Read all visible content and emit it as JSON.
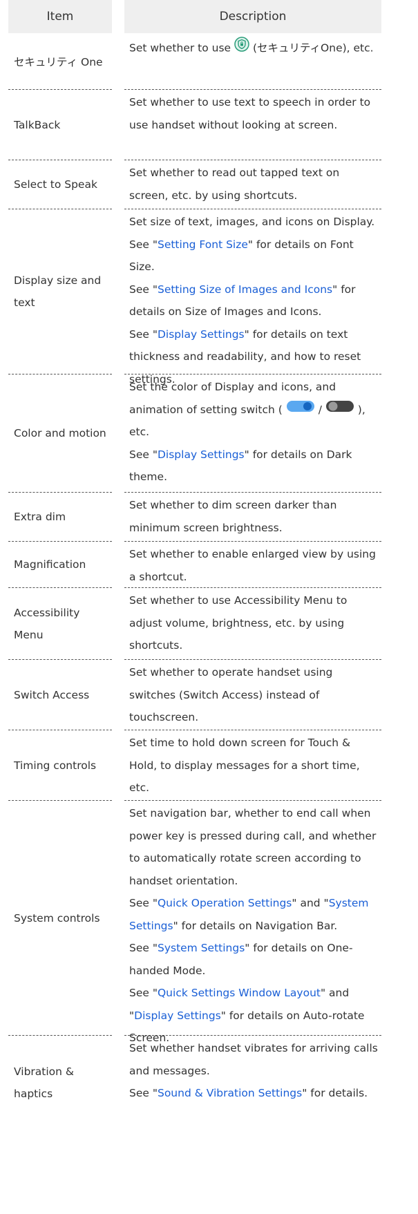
{
  "header": {
    "item": "Item",
    "description": "Description"
  },
  "rows": [
    {
      "item": "セキュリティ One",
      "desc_a": "Set whether to use ",
      "desc_b": " (セキュリティOne), etc."
    },
    {
      "item": "TalkBack",
      "desc": "Set whether to use text to speech in order to use handset without looking at screen."
    },
    {
      "item": "Select to Speak",
      "desc": "Set whether to read out tapped text on screen, etc. by using shortcuts."
    },
    {
      "item": "Display size and text",
      "desc": "Set size of text, images, and icons on Display.",
      "see1_link": "Setting Font Size",
      "see1_rest": " for details on Font Size.",
      "see2_link": "Setting Size of Images and Icons",
      "see2_rest": " for details on Size of Images and Icons.",
      "see3_link": "Display Settings",
      "see3_rest": " for details on text thickness and readability, and how to reset settings."
    },
    {
      "item": "Color and motion",
      "desc_a": "Set the color of Display and icons, and animation of setting switch ( ",
      "desc_b": " / ",
      "desc_c": " ), etc.",
      "see1_link": "Display Settings",
      "see1_rest": " for details on Dark theme."
    },
    {
      "item": "Extra dim",
      "desc": "Set whether to dim screen darker than minimum screen brightness."
    },
    {
      "item": "Magnification",
      "desc": "Set whether to enable enlarged view by using a shortcut."
    },
    {
      "item": "Accessibility Menu",
      "desc": "Set whether to use Accessibility Menu to adjust volume, brightness, etc. by using shortcuts."
    },
    {
      "item": "Switch Access",
      "desc": "Set whether to operate handset using switches (Switch Access) instead of touchscreen."
    },
    {
      "item": "Timing controls",
      "desc": "Set time to hold down screen for Touch & Hold, to display messages for a short time, etc."
    },
    {
      "item": "System controls",
      "desc": "Set navigation bar, whether to end call when power key is pressed during call, and whether to automatically rotate screen according to handset orientation.",
      "see1_link": "Quick Operation Settings",
      "see1_mid": " and ",
      "see1_link2": "System Settings",
      "see1_rest": " for details on Navigation Bar.",
      "see2_link": "System Settings",
      "see2_rest": " for details on One-handed Mode.",
      "see3_link": "Quick Settings Window Layout",
      "see3_mid": " and ",
      "see3_link2": "Display Settings",
      "see3_rest": " for details on Auto-rotate Screen."
    },
    {
      "item": "Vibration & haptics",
      "desc": "Set whether handset vibrates for arriving calls and messages.",
      "see1_link": "Sound & Vibration Settings",
      "see1_rest": " for details."
    }
  ],
  "labels": {
    "see": "See ",
    "quote": "\""
  },
  "colors": {
    "header_bg": "#efefef",
    "link": "#1a5fd6",
    "toggle_on": "#5aa8f0",
    "toggle_knob_on": "#1565c0",
    "toggle_off": "#444444",
    "shield": "#2a9d7a"
  },
  "icons": {
    "security": "shield-lock-icon",
    "switch_on": "toggle-on-icon",
    "switch_off": "toggle-off-icon"
  }
}
